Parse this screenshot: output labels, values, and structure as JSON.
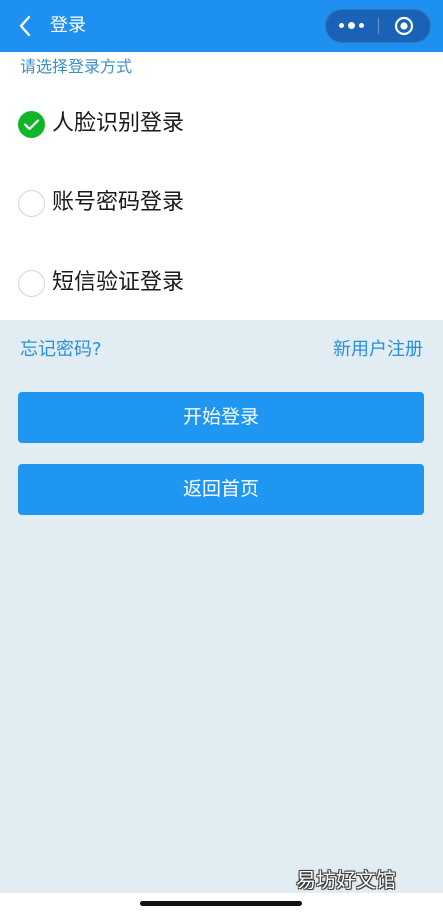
{
  "header": {
    "title": "登录",
    "background_color": "#1e90f0",
    "back_icon": "chevron-left-icon",
    "more_icon": "more-dots-icon",
    "close_icon": "target-circle-icon"
  },
  "login": {
    "section_label": "请选择登录方式",
    "options": [
      {
        "label": "人脸识别登录",
        "selected": true
      },
      {
        "label": "账号密码登录",
        "selected": false
      },
      {
        "label": "短信验证登录",
        "selected": false
      }
    ],
    "check_color": "#12b428"
  },
  "links": {
    "forgot_password": "忘记密码?",
    "register": "新用户注册"
  },
  "buttons": {
    "start_login": "开始登录",
    "back_home": "返回首页",
    "color": "#1e96f2"
  },
  "watermark": "易坊好文馆"
}
